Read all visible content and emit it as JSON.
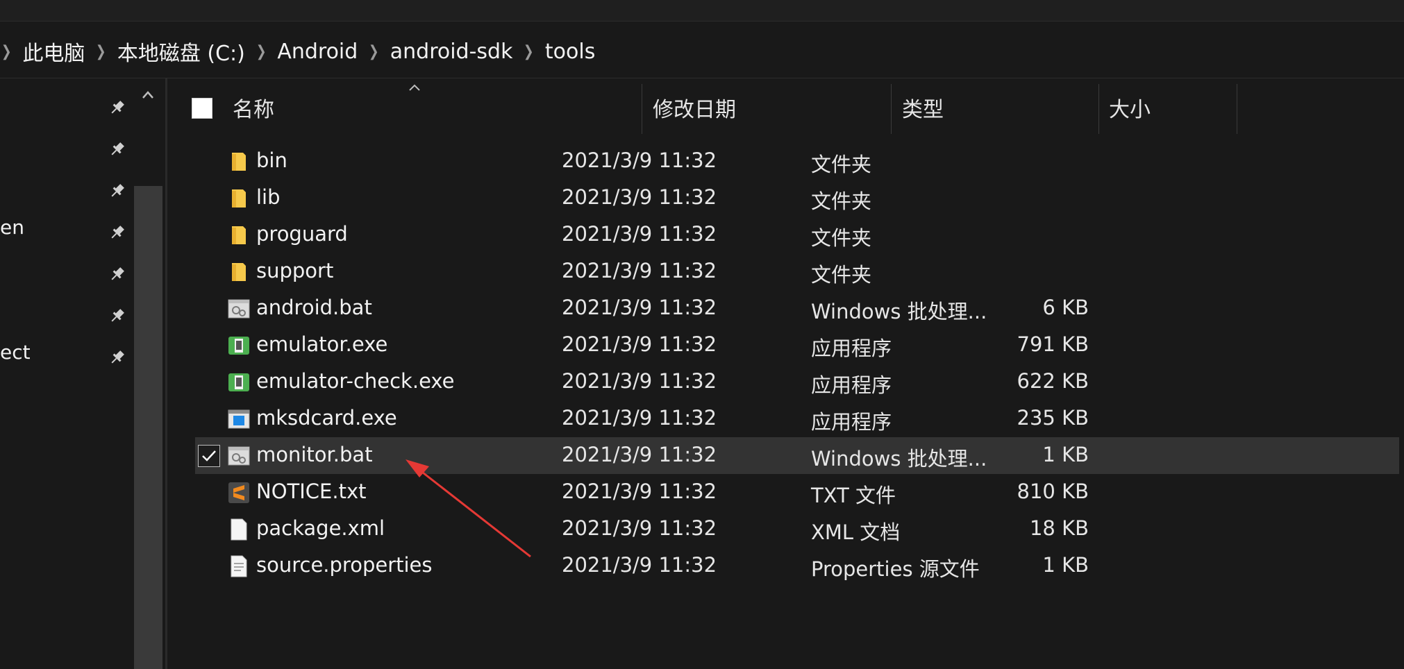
{
  "breadcrumb": {
    "items": [
      "此电脑",
      "本地磁盘 (C:)",
      "Android",
      "android-sdk",
      "tools"
    ]
  },
  "nav": {
    "partial_labels": [
      "en",
      "ect"
    ]
  },
  "columns": {
    "name": "名称",
    "modified": "修改日期",
    "type": "类型",
    "size": "大小"
  },
  "files": [
    {
      "name": "bin",
      "modified": "2021/3/9 11:32",
      "type": "文件夹",
      "size": "",
      "icon": "folder-icon"
    },
    {
      "name": "lib",
      "modified": "2021/3/9 11:32",
      "type": "文件夹",
      "size": "",
      "icon": "folder-icon"
    },
    {
      "name": "proguard",
      "modified": "2021/3/9 11:32",
      "type": "文件夹",
      "size": "",
      "icon": "folder-icon"
    },
    {
      "name": "support",
      "modified": "2021/3/9 11:32",
      "type": "文件夹",
      "size": "",
      "icon": "folder-icon"
    },
    {
      "name": "android.bat",
      "modified": "2021/3/9 11:32",
      "type": "Windows 批处理...",
      "size": "6 KB",
      "icon": "batch-file-icon"
    },
    {
      "name": "emulator.exe",
      "modified": "2021/3/9 11:32",
      "type": "应用程序",
      "size": "791 KB",
      "icon": "emulator-icon"
    },
    {
      "name": "emulator-check.exe",
      "modified": "2021/3/9 11:32",
      "type": "应用程序",
      "size": "622 KB",
      "icon": "emulator-icon"
    },
    {
      "name": "mksdcard.exe",
      "modified": "2021/3/9 11:32",
      "type": "应用程序",
      "size": "235 KB",
      "icon": "app-window-icon"
    },
    {
      "name": "monitor.bat",
      "modified": "2021/3/9 11:32",
      "type": "Windows 批处理...",
      "size": "1 KB",
      "icon": "batch-file-icon",
      "selected": true
    },
    {
      "name": "NOTICE.txt",
      "modified": "2021/3/9 11:32",
      "type": "TXT 文件",
      "size": "810 KB",
      "icon": "sublime-text-icon"
    },
    {
      "name": "package.xml",
      "modified": "2021/3/9 11:32",
      "type": "XML 文档",
      "size": "18 KB",
      "icon": "blank-file-icon"
    },
    {
      "name": "source.properties",
      "modified": "2021/3/9 11:32",
      "type": "Properties 源文件",
      "size": "1 KB",
      "icon": "text-file-icon"
    }
  ],
  "colors": {
    "background": "#191919",
    "selected_row": "#333333",
    "folder": "#f6c94b",
    "emulator": "#4caf50",
    "sublime": "#f28a1e",
    "annotation_arrow": "#e53935"
  }
}
